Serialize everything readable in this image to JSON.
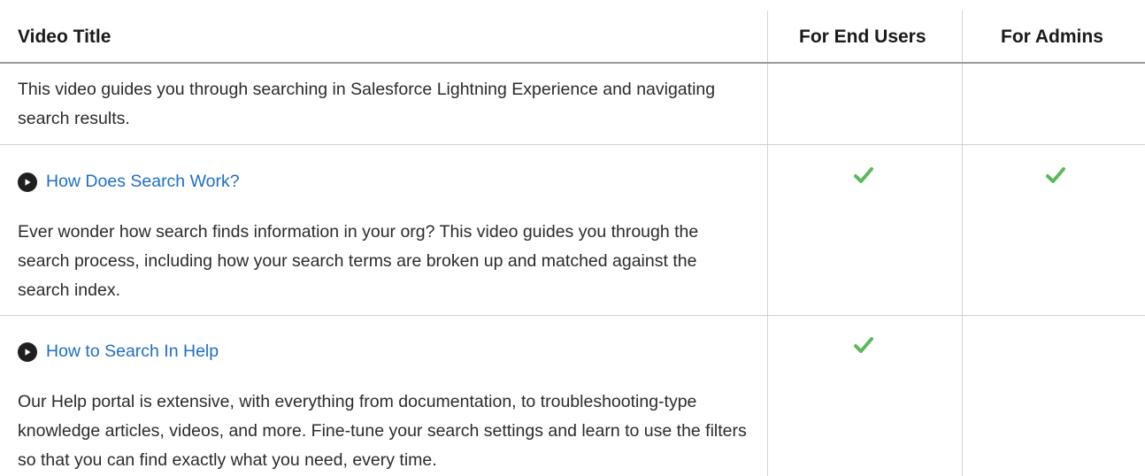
{
  "headers": {
    "title": "Video Title",
    "end_users": "For End Users",
    "admins": "For Admins"
  },
  "rows": [
    {
      "intro": "This video guides you through searching in Salesforce Lightning Experience and navigating search results."
    },
    {
      "link": "How Does Search Work?",
      "icon": "play-circle-icon",
      "description": "Ever wonder how search finds information in your org? This video guides you through the search process, including how your search terms are broken up and matched against the search index.",
      "for_end_users": true,
      "for_admins": true
    },
    {
      "link": "How to Search In Help",
      "icon": "play-circle-icon",
      "description": "Our Help portal is extensive, with everything from documentation, to troubleshooting-type knowledge articles, videos, and more. Fine-tune your search settings and learn to use the filters so that you can find exactly what you need, every time.",
      "for_end_users": true,
      "for_admins": false
    }
  ],
  "colors": {
    "link": "#1f6fc5",
    "check": "#5cb85c",
    "rule": "#cfcfcf"
  }
}
